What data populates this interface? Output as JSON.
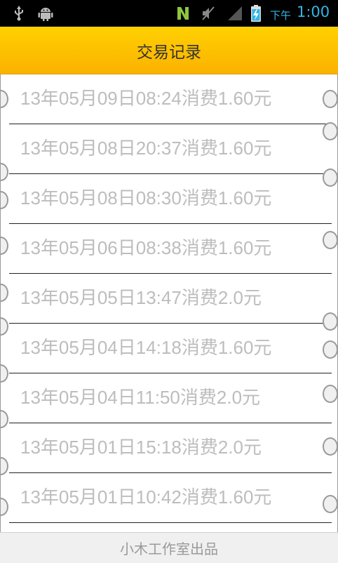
{
  "status_bar": {
    "icons_left": [
      "usb-icon",
      "android-debug-icon"
    ],
    "icons_right": [
      "n-app-icon",
      "vibrate-mute-icon",
      "signal-icon",
      "battery-charging-icon"
    ],
    "ampm": "下午",
    "time": "1:00",
    "accent_color": "#33b5e5"
  },
  "header": {
    "title": "交易记录",
    "color": "#ffc400"
  },
  "records": [
    "13年05月09日08:24消费1.60元",
    "13年05月08日20:37消费1.60元",
    "13年05月08日08:30消费1.60元",
    "13年05月06日08:38消费1.60元",
    "13年05月05日13:47消费2.0元",
    "13年05月04日14:18消费1.60元",
    "13年05月04日11:50消费2.0元",
    "13年05月01日15:18消费2.0元",
    "13年05月01日10:42消费1.60元"
  ],
  "footer": {
    "text": "小木工作室出品"
  }
}
